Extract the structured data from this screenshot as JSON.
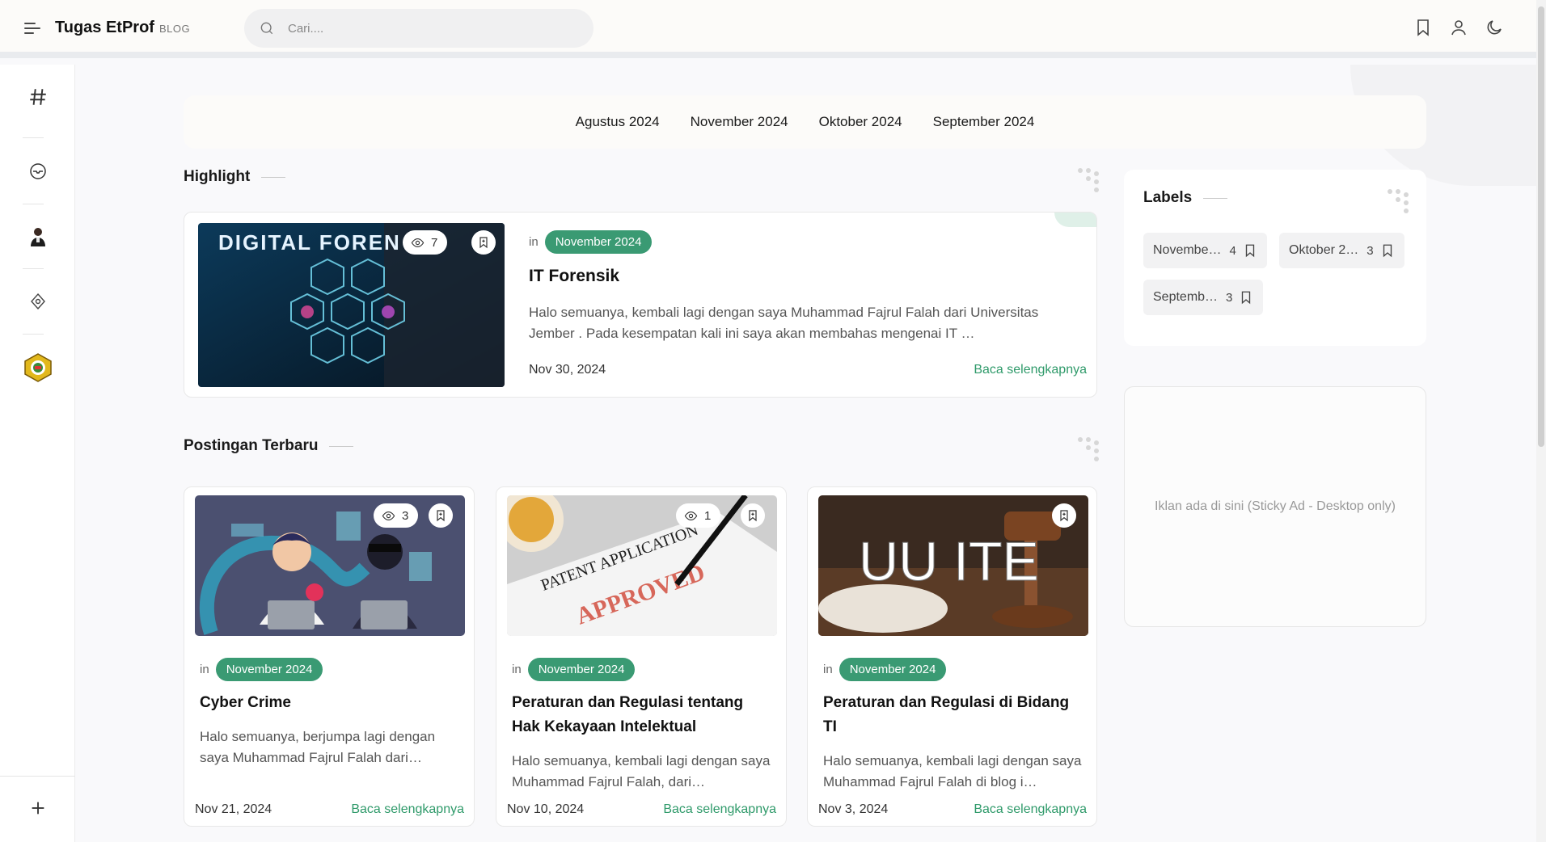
{
  "header": {
    "brand": "Tugas EtProf",
    "brand_sub": "BLOG",
    "search_placeholder": "Cari...."
  },
  "nav": {
    "months": [
      "Agustus 2024",
      "November 2024",
      "Oktober 2024",
      "September 2024"
    ]
  },
  "highlight": {
    "section_title": "Highlight",
    "post": {
      "views": "7",
      "in_text": "in",
      "label": "November 2024",
      "title": "IT Forensik",
      "excerpt": "Halo semuanya, kembali lagi dengan saya Muhammad Fajrul Falah dari Universitas Jember . Pada kesempatan kali ini saya akan membahas mengenai IT …",
      "date": "Nov 30, 2024",
      "read_more": "Baca selengkapnya",
      "image_text": "DIGITAL FOREN"
    }
  },
  "recent": {
    "section_title": "Postingan Terbaru",
    "posts": [
      {
        "views": "3",
        "in_text": "in",
        "label": "November 2024",
        "title": "Cyber Crime",
        "excerpt": "Halo semuanya, berjumpa lagi dengan saya Muhammad Fajrul Falah dari…",
        "date": "Nov 21, 2024",
        "read_more": "Baca selengkapnya"
      },
      {
        "views": "1",
        "in_text": "in",
        "label": "November 2024",
        "title": "Peraturan dan Regulasi tentang Hak Kekayaan Intelektual",
        "excerpt": "Halo semuanya, kembali lagi dengan saya Muhammad Fajrul Falah, dari…",
        "date": "Nov 10, 2024",
        "read_more": "Baca selengkapnya",
        "image_text_1": "PATENT APPLICATION",
        "image_text_2": "APPROVED"
      },
      {
        "in_text": "in",
        "label": "November 2024",
        "title": "Peraturan dan Regulasi di Bidang TI",
        "excerpt": "Halo semuanya, kembali lagi dengan saya Muhammad Fajrul Falah di blog i…",
        "date": "Nov 3, 2024",
        "read_more": "Baca selengkapnya",
        "image_text": "UU ITE"
      }
    ]
  },
  "labels_widget": {
    "title": "Labels",
    "items": [
      {
        "name": "Novembe…",
        "count": "4"
      },
      {
        "name": "Oktober 2…",
        "count": "3"
      },
      {
        "name": "Septemb…",
        "count": "3"
      }
    ]
  },
  "ad": {
    "text": "Iklan ada di sini (Sticky Ad - Desktop only)"
  },
  "colors": {
    "accent": "#3a9a73",
    "link": "#2f9a6a"
  }
}
